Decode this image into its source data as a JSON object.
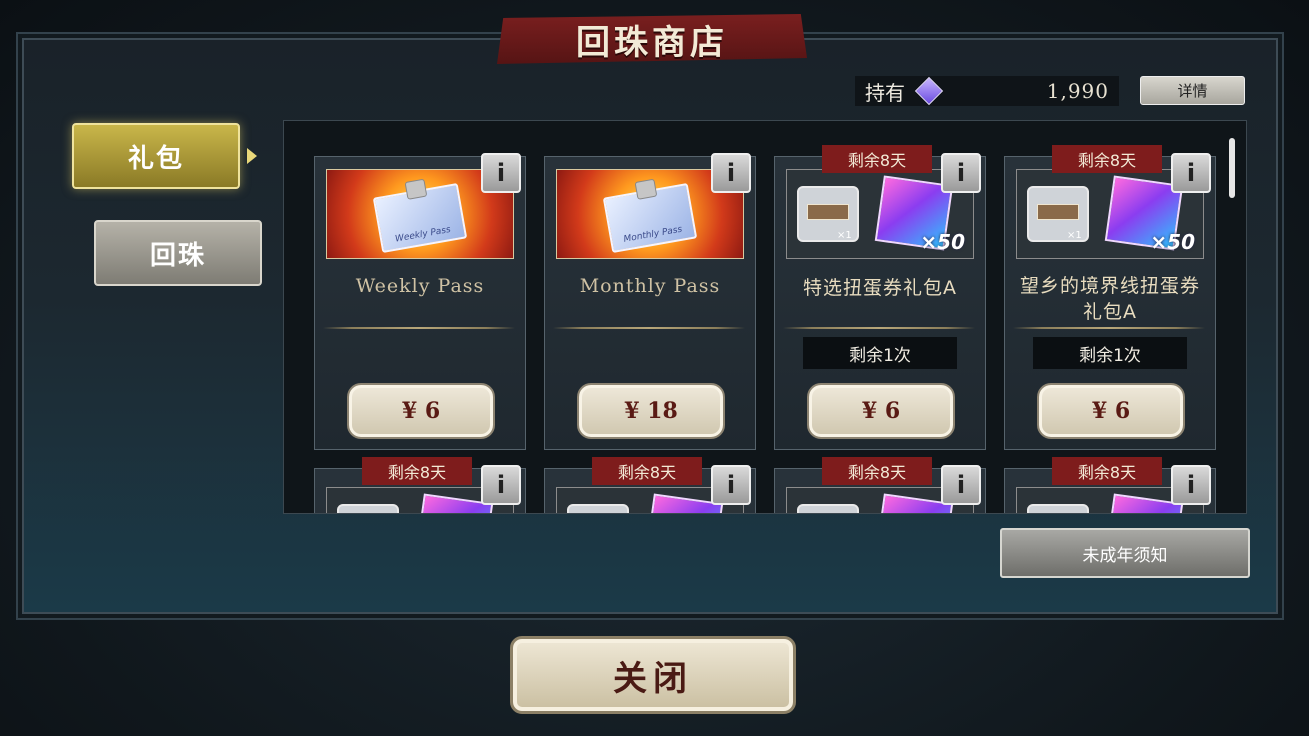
{
  "title": "回珠商店",
  "holdings": {
    "label": "持有",
    "currency_icon": "gem-icon",
    "amount": "1,990"
  },
  "detail_button": "详情",
  "tabs": [
    {
      "label": "礼包",
      "active": true
    },
    {
      "label": "回珠",
      "active": false
    }
  ],
  "cards": [
    {
      "timer": "",
      "image": "weekly-pass-icon",
      "image_text": "Weekly Pass",
      "title": "Weekly Pass",
      "remaining": "",
      "price": "¥ 6"
    },
    {
      "timer": "",
      "image": "monthly-pass-icon",
      "image_text": "Monthly Pass",
      "title": "Monthly Pass",
      "remaining": "",
      "price": "¥ 18"
    },
    {
      "timer": "剩余8天",
      "image": "gacha-bundle-icon",
      "multiplier_small": "×1",
      "multiplier": "×50",
      "title": "特选扭蛋券礼包A",
      "remaining": "剩余1次",
      "price": "¥ 6"
    },
    {
      "timer": "剩余8天",
      "image": "gacha-bundle-icon",
      "multiplier_small": "×1",
      "multiplier": "×50",
      "title_line1": "望乡的境界线扭蛋券",
      "title_line2": "礼包A",
      "remaining": "剩余1次",
      "price": "¥ 6"
    }
  ],
  "second_row_timers": [
    "剩余8天",
    "剩余8天",
    "剩余8天",
    "剩余8天"
  ],
  "info_label": "i",
  "minor_notice_button": "未成年须知",
  "close_button": "关闭"
}
